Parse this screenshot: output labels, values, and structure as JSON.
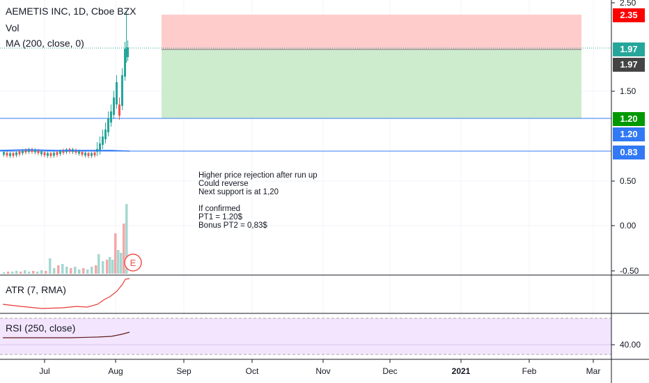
{
  "legend": {
    "title": "AEMETIS INC, 1D, Cboe BZX",
    "vol": "Vol",
    "ma": "MA (200, close, 0)",
    "atr": "ATR (7, RMA)",
    "rsi": "RSI (250, close)"
  },
  "note": {
    "lines": [
      "Higher price rejection after run up",
      "Could reverse",
      "Next support is at 1,20",
      "",
      "If confirmed",
      "PT1 = 1.20$",
      "Bonus PT2 = 0,83$"
    ]
  },
  "price_axis": {
    "ticks": [
      "2.50",
      "1.50",
      "0.50",
      "0.00",
      "-0.50"
    ],
    "rsi_tick": "40.00"
  },
  "badges": [
    {
      "label": "2.35",
      "color": "#ff0000"
    },
    {
      "label": "1.97",
      "color": "#26a69a"
    },
    {
      "label": "1.97",
      "color": "#444444"
    },
    {
      "label": "1.20",
      "color": "#009900"
    },
    {
      "label": "1.20",
      "color": "#3179f5"
    },
    {
      "label": "0.83",
      "color": "#3179f5"
    }
  ],
  "time_axis": [
    "Jul",
    "Aug",
    "Sep",
    "Oct",
    "Nov",
    "Dec",
    "2021",
    "Feb",
    "Mar"
  ],
  "earnings_marker": "E",
  "colors": {
    "up": "#26a69a",
    "down": "#ef5350",
    "stop_zone": "#ffcccc",
    "target_zone": "#cdebcd",
    "hline": "#3179f5",
    "rsi_bg": "#f3e5fd",
    "atr_line": "#e53935"
  }
}
